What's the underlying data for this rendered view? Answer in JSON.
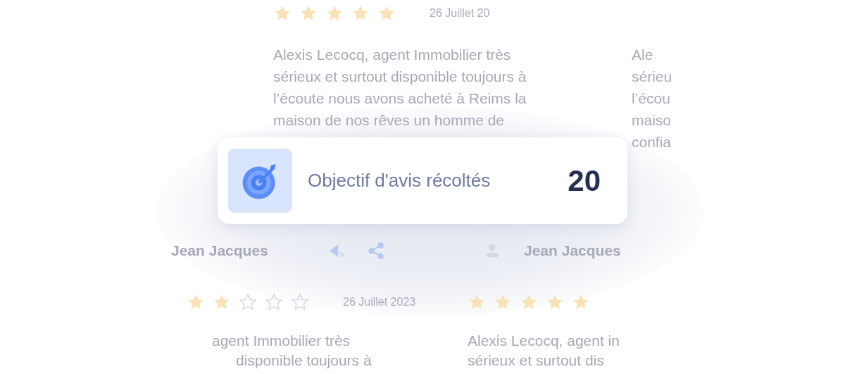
{
  "reviews": [
    {
      "kind": "top",
      "stars": 5,
      "date": "26 Juillet 20",
      "lines": [
        "Alexis Lecocq, agent Immobilier très",
        "sérieux et surtout disponible toujours à",
        "l’écoute nous avons acheté à Reims la",
        "maison de nos rêves un homme de"
      ]
    },
    {
      "kind": "top-side",
      "lines": [
        "Ale",
        "sérieu",
        "l’écou",
        "maiso",
        "confia"
      ]
    },
    {
      "kind": "bottom-left",
      "name": "Jean Jacques",
      "stars": 2,
      "date": "26 Juillet 2023",
      "lines": [
        "agent Immobilier très",
        "disponible toujours à"
      ]
    },
    {
      "kind": "bottom-right",
      "name": "Jean Jacques",
      "stars": 5,
      "lines": [
        "Alexis Lecocq, agent in",
        "sérieux et surtout dis"
      ]
    }
  ],
  "goal": {
    "label": "Objectif d'avis récoltés",
    "value": "20"
  }
}
